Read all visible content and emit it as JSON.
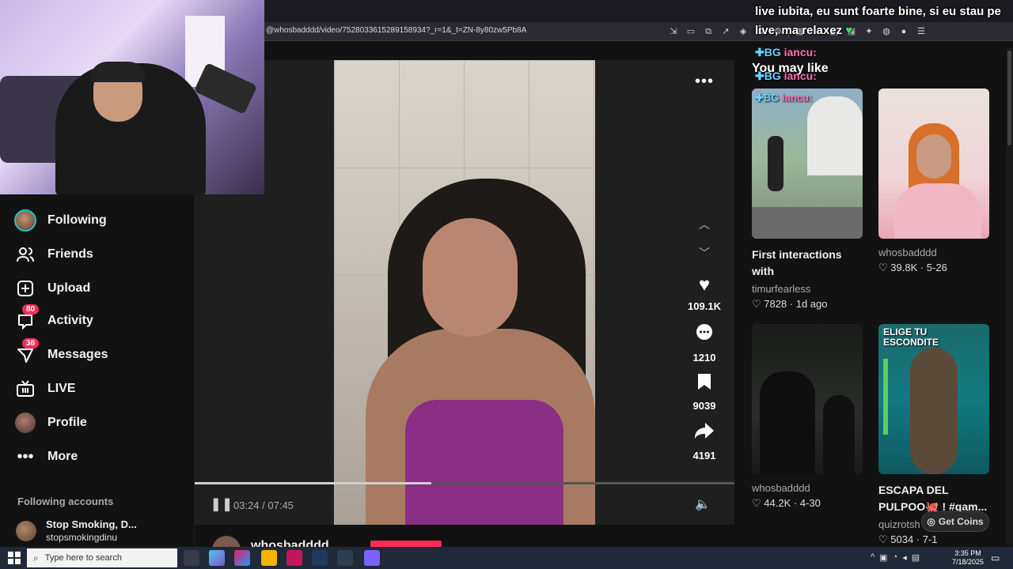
{
  "browser": {
    "url": "@whosbadddd/video/7528033615289158934?_r=1&_t=ZN-8y80zw5Pb8A"
  },
  "chat": {
    "line1": "live iubita, eu sunt foarte bine, si eu stau pe",
    "line2": "live, ma relaxez",
    "user1": "iancu:",
    "user2": "iancu:",
    "user3": "iancu:"
  },
  "sidebar": {
    "items": [
      {
        "label": "Following",
        "icon": "avatar-icon"
      },
      {
        "label": "Friends",
        "icon": "friends-icon"
      },
      {
        "label": "Upload",
        "icon": "plus-square-icon"
      },
      {
        "label": "Activity",
        "icon": "inbox-icon",
        "badge": "80"
      },
      {
        "label": "Messages",
        "icon": "send-icon",
        "badge": "38"
      },
      {
        "label": "LIVE",
        "icon": "live-tv-icon"
      },
      {
        "label": "Profile",
        "icon": "profile-avatar-icon"
      },
      {
        "label": "More",
        "icon": "more-dots-icon"
      }
    ],
    "following_accounts_title": "Following accounts",
    "account": {
      "name": "Stop Smoking, D...",
      "handle": "stopsmokingdinu"
    }
  },
  "video": {
    "actions": {
      "likes": "109.1K",
      "comments": "1210",
      "saves": "9039",
      "shares": "4191"
    },
    "time_current": "03:24",
    "time_total": "07:45",
    "time_text": "03:24 / 07:45",
    "progress": 0.439,
    "author": "whosbadddd"
  },
  "may_like": {
    "title": "You may like",
    "cards": [
      {
        "title": "First interactions with @IShowSpeed...",
        "author": "timurfearless",
        "likes": "7828",
        "age": "1d ago",
        "stats": "♡ 7828 · 1d ago"
      },
      {
        "title": "",
        "author": "whosbadddd",
        "likes": "39.8K",
        "age": "5-26",
        "stats": "♡ 39.8K · 5-26"
      },
      {
        "title": "",
        "author": "whosbadddd",
        "likes": "44.2K",
        "age": "4-30",
        "stats": "♡ 44.2K · 4-30"
      },
      {
        "title": "ESCAPA DEL PULPOO🐙 ! #gam...",
        "author": "quizrotsh",
        "likes": "5034",
        "age": "7-1",
        "stats": "♡ 5034 · 7-1"
      }
    ],
    "thumb3_text": "ELIGE TU ESCONDITE"
  },
  "get_coins": "Get Coins",
  "taskbar": {
    "search_placeholder": "Type here to search",
    "time": "3:35 PM",
    "date": "7/18/2025"
  },
  "colors": {
    "accent": "#fe2c55",
    "background": "#121212"
  }
}
